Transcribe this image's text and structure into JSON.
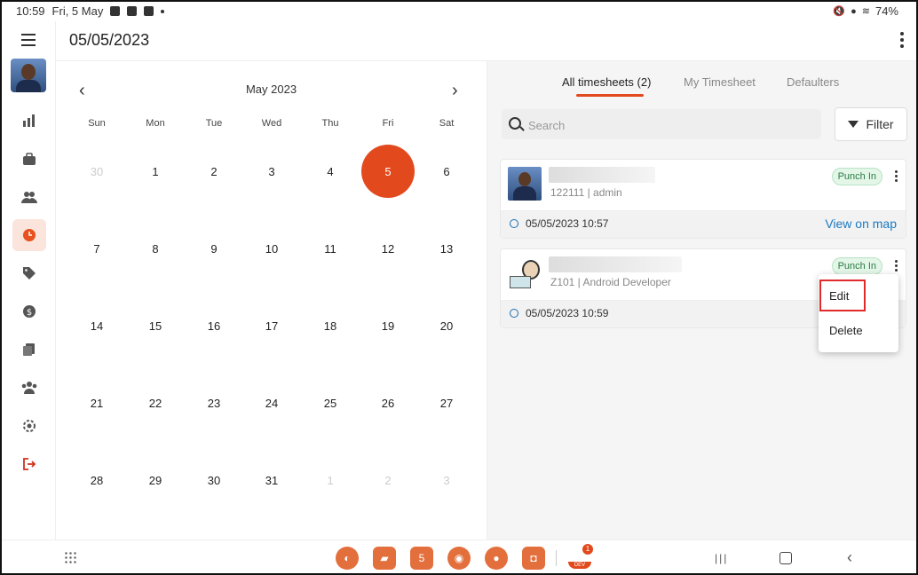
{
  "status_bar": {
    "time": "10:59",
    "date": "Fri, 5 May",
    "battery": "74%"
  },
  "header": {
    "title": "05/05/2023"
  },
  "sidebar": {
    "items": [
      {
        "icon": "chart-icon"
      },
      {
        "icon": "briefcase-icon"
      },
      {
        "icon": "users-icon"
      },
      {
        "icon": "clock-icon",
        "active": true
      },
      {
        "icon": "tag-icon"
      },
      {
        "icon": "dollar-icon"
      },
      {
        "icon": "documents-icon"
      },
      {
        "icon": "team-icon"
      },
      {
        "icon": "settings-icon"
      },
      {
        "icon": "logout-icon"
      }
    ]
  },
  "calendar": {
    "month_label": "May 2023",
    "weekdays": [
      "Sun",
      "Mon",
      "Tue",
      "Wed",
      "Thu",
      "Fri",
      "Sat"
    ],
    "weeks": [
      [
        "30",
        "1",
        "2",
        "3",
        "4",
        "5",
        "6"
      ],
      [
        "7",
        "8",
        "9",
        "10",
        "11",
        "12",
        "13"
      ],
      [
        "14",
        "15",
        "16",
        "17",
        "18",
        "19",
        "20"
      ],
      [
        "21",
        "22",
        "23",
        "24",
        "25",
        "26",
        "27"
      ],
      [
        "28",
        "29",
        "30",
        "31",
        "1",
        "2",
        "3"
      ]
    ],
    "selected_day": "5"
  },
  "tabs": [
    {
      "label": "All timesheets (2)",
      "active": true
    },
    {
      "label": "My Timesheet",
      "active": false
    },
    {
      "label": "Defaulters",
      "active": false
    }
  ],
  "search": {
    "placeholder": "Search"
  },
  "filter_label": "Filter",
  "timesheets": [
    {
      "id_role": "122111 | admin",
      "status": "Punch In",
      "timestamp": "05/05/2023 10:57",
      "map_link": "View on map"
    },
    {
      "id_role": "Z101 | Android Developer",
      "status": "Punch In",
      "timestamp": "05/05/2023 10:59"
    }
  ],
  "context_menu": {
    "edit": "Edit",
    "delete": "Delete"
  },
  "taskbar": {
    "calendar_app_label": "5",
    "notification_count": "1",
    "dev_label": "DEV"
  },
  "colors": {
    "accent": "#e24a1e",
    "badge_bg": "#e3f6e8",
    "badge_text": "#2b7a44",
    "link": "#1a79c2",
    "highlight_box": "#e12a2a"
  }
}
